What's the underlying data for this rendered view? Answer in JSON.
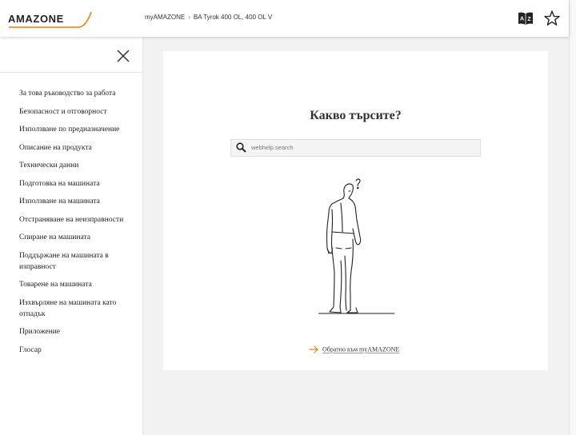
{
  "header": {
    "logo_text": "AMAZONE",
    "breadcrumb": [
      "myAMAZONE",
      "BA Tyrok 400 OL, 400 OL V"
    ],
    "breadcrumb_separator": "›",
    "icons": [
      "glossary-az-icon",
      "star-icon"
    ],
    "brand_color": "#f07d00"
  },
  "sidebar": {
    "close_icon": "close-icon",
    "items": [
      "За това ръководство за работа",
      "Безопасност и отговорност",
      "Използване по предназначение",
      "Описание на продукта",
      "Технически данни",
      "Подготовка на машината",
      "Използване на машината",
      "Отстраняване на неизправности",
      "Спиране на машината",
      "Поддържане на машината в изправност",
      "Товарене на машината",
      "Изхвърляне на машината като отпадък",
      "Приложение",
      "Глосар"
    ]
  },
  "main": {
    "title": "Какво търсите?",
    "search_placeholder": "webhelp.search",
    "search_icon": "search-icon",
    "illustration": "confused-man-illustration",
    "back_link": "Обратно към myAMAZONE",
    "back_icon": "arrow-right-icon"
  }
}
